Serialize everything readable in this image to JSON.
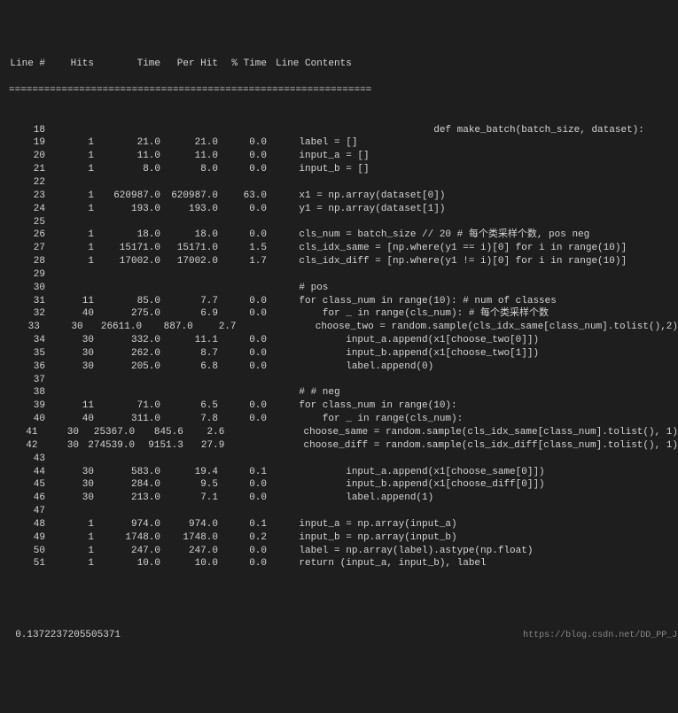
{
  "headers": {
    "line": "Line #",
    "hits": "Hits",
    "time": "Time",
    "perhit": "Per Hit",
    "pct": "% Time",
    "contents": "Line Contents"
  },
  "rule": "==============================================================",
  "rows": [
    {
      "line": "18",
      "hits": "",
      "time": "",
      "perhit": "",
      "pct": "",
      "code": "                           def make_batch(batch_size, dataset):"
    },
    {
      "line": "19",
      "hits": "1",
      "time": "21.0",
      "perhit": "21.0",
      "pct": "0.0",
      "code": "    label = []"
    },
    {
      "line": "20",
      "hits": "1",
      "time": "11.0",
      "perhit": "11.0",
      "pct": "0.0",
      "code": "    input_a = []"
    },
    {
      "line": "21",
      "hits": "1",
      "time": "8.0",
      "perhit": "8.0",
      "pct": "0.0",
      "code": "    input_b = []"
    },
    {
      "line": "22",
      "hits": "",
      "time": "",
      "perhit": "",
      "pct": "",
      "code": ""
    },
    {
      "line": "23",
      "hits": "1",
      "time": "620987.0",
      "perhit": "620987.0",
      "pct": "63.0",
      "code": "    x1 = np.array(dataset[0])"
    },
    {
      "line": "24",
      "hits": "1",
      "time": "193.0",
      "perhit": "193.0",
      "pct": "0.0",
      "code": "    y1 = np.array(dataset[1])"
    },
    {
      "line": "25",
      "hits": "",
      "time": "",
      "perhit": "",
      "pct": "",
      "code": ""
    },
    {
      "line": "26",
      "hits": "1",
      "time": "18.0",
      "perhit": "18.0",
      "pct": "0.0",
      "code": "    cls_num = batch_size // 20 # 每个类采样个数, pos neg"
    },
    {
      "line": "27",
      "hits": "1",
      "time": "15171.0",
      "perhit": "15171.0",
      "pct": "1.5",
      "code": "    cls_idx_same = [np.where(y1 == i)[0] for i in range(10)]"
    },
    {
      "line": "28",
      "hits": "1",
      "time": "17002.0",
      "perhit": "17002.0",
      "pct": "1.7",
      "code": "    cls_idx_diff = [np.where(y1 != i)[0] for i in range(10)]"
    },
    {
      "line": "29",
      "hits": "",
      "time": "",
      "perhit": "",
      "pct": "",
      "code": ""
    },
    {
      "line": "30",
      "hits": "",
      "time": "",
      "perhit": "",
      "pct": "",
      "code": "    # pos"
    },
    {
      "line": "31",
      "hits": "11",
      "time": "85.0",
      "perhit": "7.7",
      "pct": "0.0",
      "code": "    for class_num in range(10): # num of classes"
    },
    {
      "line": "32",
      "hits": "40",
      "time": "275.0",
      "perhit": "6.9",
      "pct": "0.0",
      "code": "        for _ in range(cls_num): # 每个类采样个数"
    },
    {
      "line": "33",
      "hits": "30",
      "time": "26611.0",
      "perhit": "887.0",
      "pct": "2.7",
      "code": "            choose_two = random.sample(cls_idx_same[class_num].tolist(),2)"
    },
    {
      "line": "34",
      "hits": "30",
      "time": "332.0",
      "perhit": "11.1",
      "pct": "0.0",
      "code": "            input_a.append(x1[choose_two[0]])"
    },
    {
      "line": "35",
      "hits": "30",
      "time": "262.0",
      "perhit": "8.7",
      "pct": "0.0",
      "code": "            input_b.append(x1[choose_two[1]])"
    },
    {
      "line": "36",
      "hits": "30",
      "time": "205.0",
      "perhit": "6.8",
      "pct": "0.0",
      "code": "            label.append(0)"
    },
    {
      "line": "37",
      "hits": "",
      "time": "",
      "perhit": "",
      "pct": "",
      "code": ""
    },
    {
      "line": "38",
      "hits": "",
      "time": "",
      "perhit": "",
      "pct": "",
      "code": "    # # neg"
    },
    {
      "line": "39",
      "hits": "11",
      "time": "71.0",
      "perhit": "6.5",
      "pct": "0.0",
      "code": "    for class_num in range(10):"
    },
    {
      "line": "40",
      "hits": "40",
      "time": "311.0",
      "perhit": "7.8",
      "pct": "0.0",
      "code": "        for _ in range(cls_num):"
    },
    {
      "line": "41",
      "hits": "30",
      "time": "25367.0",
      "perhit": "845.6",
      "pct": "2.6",
      "code": "            choose_same = random.sample(cls_idx_same[class_num].tolist(), 1)"
    },
    {
      "line": "42",
      "hits": "30",
      "time": "274539.0",
      "perhit": "9151.3",
      "pct": "27.9",
      "code": "            choose_diff = random.sample(cls_idx_diff[class_num].tolist(), 1)"
    },
    {
      "line": "43",
      "hits": "",
      "time": "",
      "perhit": "",
      "pct": "",
      "code": ""
    },
    {
      "line": "44",
      "hits": "30",
      "time": "583.0",
      "perhit": "19.4",
      "pct": "0.1",
      "code": "            input_a.append(x1[choose_same[0]])"
    },
    {
      "line": "45",
      "hits": "30",
      "time": "284.0",
      "perhit": "9.5",
      "pct": "0.0",
      "code": "            input_b.append(x1[choose_diff[0]])"
    },
    {
      "line": "46",
      "hits": "30",
      "time": "213.0",
      "perhit": "7.1",
      "pct": "0.0",
      "code": "            label.append(1)"
    },
    {
      "line": "47",
      "hits": "",
      "time": "",
      "perhit": "",
      "pct": "",
      "code": ""
    },
    {
      "line": "48",
      "hits": "1",
      "time": "974.0",
      "perhit": "974.0",
      "pct": "0.1",
      "code": "    input_a = np.array(input_a)"
    },
    {
      "line": "49",
      "hits": "1",
      "time": "1748.0",
      "perhit": "1748.0",
      "pct": "0.2",
      "code": "    input_b = np.array(input_b)"
    },
    {
      "line": "50",
      "hits": "1",
      "time": "247.0",
      "perhit": "247.0",
      "pct": "0.0",
      "code": "    label = np.array(label).astype(np.float)"
    },
    {
      "line": "51",
      "hits": "1",
      "time": "10.0",
      "perhit": "10.0",
      "pct": "0.0",
      "code": "    return (input_a, input_b), label"
    }
  ],
  "footer": {
    "total": "0.1372237205505371",
    "watermark": "https://blog.csdn.net/DD_PP_JJ"
  }
}
